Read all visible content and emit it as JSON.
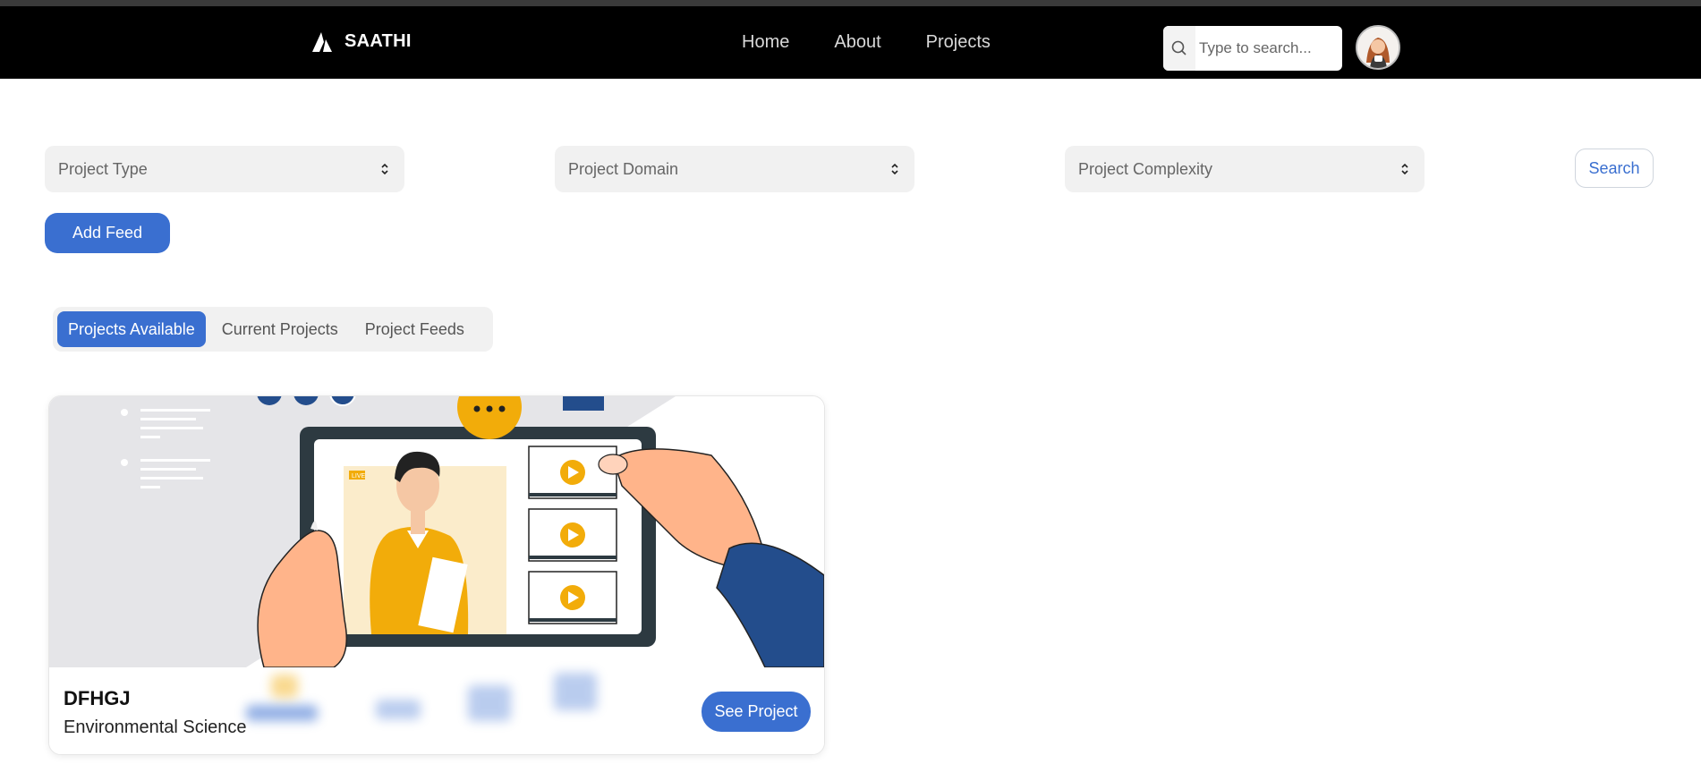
{
  "brand": {
    "name": "SAATHI"
  },
  "nav": {
    "links": [
      "Home",
      "About",
      "Projects"
    ]
  },
  "search": {
    "placeholder": "Type to search..."
  },
  "filters": {
    "project_type": "Project Type",
    "project_domain": "Project Domain",
    "project_complexity": "Project Complexity",
    "search_label": "Search"
  },
  "actions": {
    "add_feed": "Add Feed"
  },
  "tabs": [
    {
      "label": "Projects Available",
      "active": true
    },
    {
      "label": "Current Projects",
      "active": false
    },
    {
      "label": "Project Feeds",
      "active": false
    }
  ],
  "card": {
    "title": "DFHGJ",
    "subtitle": "Environmental Science",
    "button": "See Project",
    "live_tag": "LIVE"
  },
  "colors": {
    "accent": "#3a6fd0",
    "navbar": "#000000",
    "illustration_shirt": "#f2ac0a",
    "illustration_sleeve": "#234d8c"
  }
}
